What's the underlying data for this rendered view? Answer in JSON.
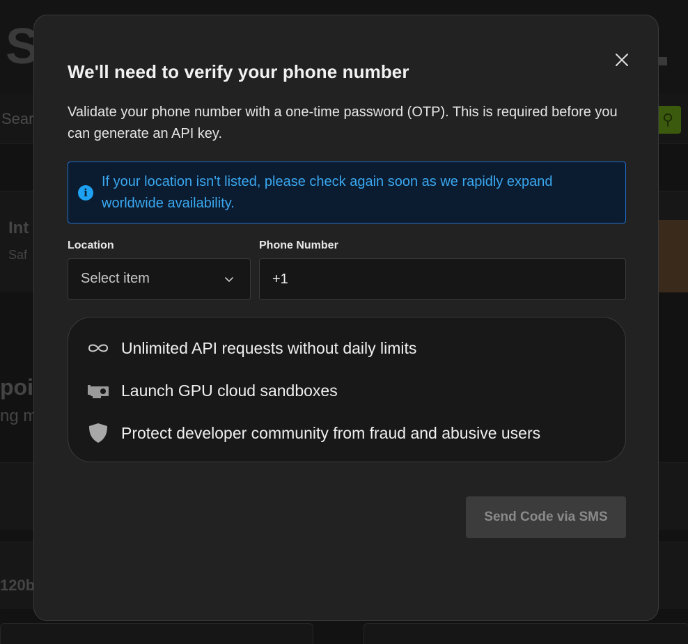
{
  "modal": {
    "title": "We'll need to verify your phone number",
    "description": "Validate your phone number with a one-time password (OTP). This is required before you can generate an API key.",
    "info_message": "If your location isn't listed, please check again soon as we rapidly expand worldwide availability.",
    "location": {
      "label": "Location",
      "placeholder": "Select item"
    },
    "phone": {
      "label": "Phone Number",
      "value": "+1"
    },
    "features": [
      {
        "icon": "infinity-icon",
        "text": "Unlimited API requests without daily limits"
      },
      {
        "icon": "gpu-card-icon",
        "text": "Launch GPU cloud sandboxes"
      },
      {
        "icon": "shield-icon",
        "text": "Protect developer community from fraud and abusive users"
      }
    ],
    "submit_label": "Send Code via SMS",
    "close_icon": "close-icon"
  },
  "background": {
    "logo_letter": "S",
    "search_placeholder": "Sear",
    "row1_title": "Int",
    "row1_sub": "Saf",
    "row2_title": "poi",
    "row2_sub": "ng m",
    "row3_text": "120b"
  },
  "colors": {
    "modal_bg": "#222222",
    "info_bg": "#0b1b30",
    "info_border": "#1f6fd1",
    "info_text": "#3aa8f0",
    "accent_green": "#76b900"
  }
}
